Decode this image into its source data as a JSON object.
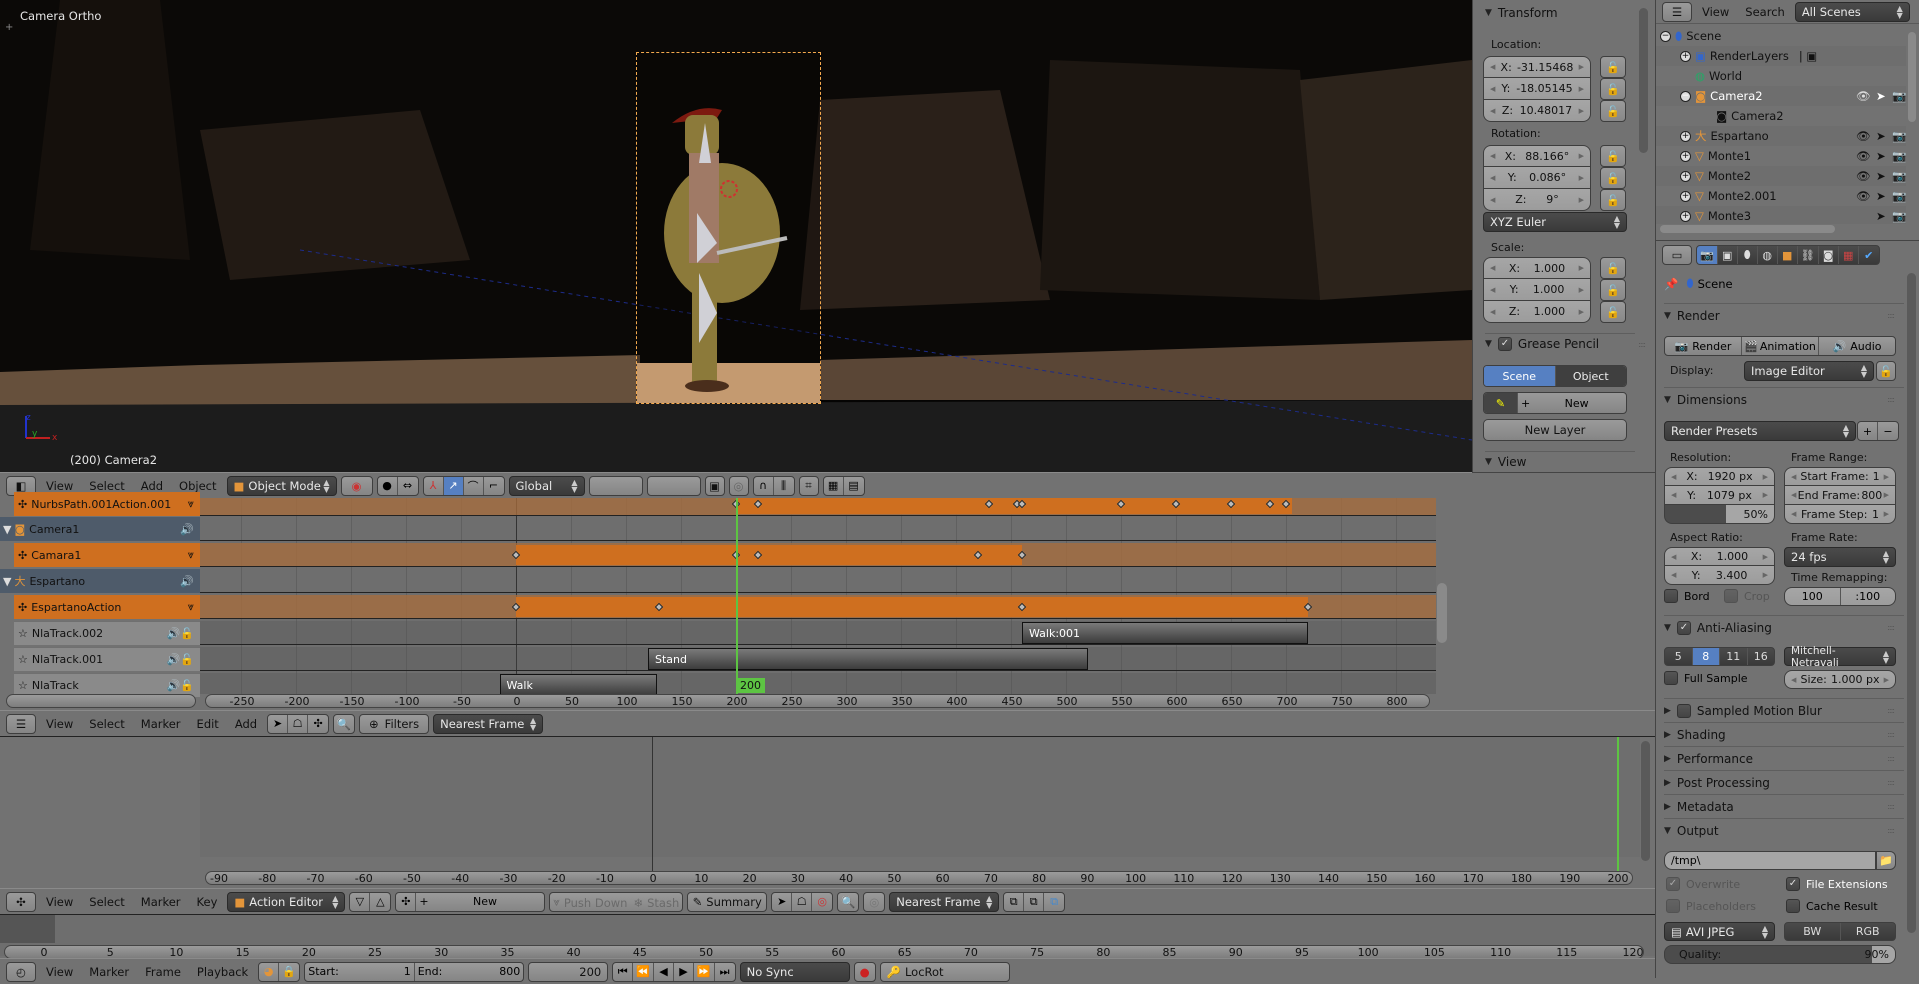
{
  "viewport": {
    "view_name": "Camera Ortho",
    "status": "(200) Camera2",
    "axes": {
      "x": "x",
      "y": "y",
      "z": "z"
    },
    "header": {
      "menus": [
        "View",
        "Select",
        "Add",
        "Object"
      ],
      "mode": "Object Mode",
      "orientation": "Global"
    }
  },
  "transform_panel": {
    "title": "Transform",
    "location_label": "Location:",
    "location": [
      {
        "axis": "X:",
        "value": "-31.15468"
      },
      {
        "axis": "Y:",
        "value": "-18.05145"
      },
      {
        "axis": "Z:",
        "value": "10.48017"
      }
    ],
    "rotation_label": "Rotation:",
    "rotation": [
      {
        "axis": "X:",
        "value": "88.166°"
      },
      {
        "axis": "Y:",
        "value": "0.086°"
      },
      {
        "axis": "Z:",
        "value": "9°"
      }
    ],
    "rotation_mode": "XYZ Euler",
    "scale_label": "Scale:",
    "scale": [
      {
        "axis": "X:",
        "value": "1.000"
      },
      {
        "axis": "Y:",
        "value": "1.000"
      },
      {
        "axis": "Z:",
        "value": "1.000"
      }
    ],
    "grease_pencil": {
      "title": "Grease Pencil",
      "enabled": true,
      "scene_label": "Scene",
      "object_label": "Object",
      "active": "Scene",
      "new_label": "New",
      "new_layer_label": "New Layer"
    },
    "view_title": "View"
  },
  "outliner": {
    "menus": [
      "View",
      "Search"
    ],
    "filter": "All Scenes",
    "items": [
      {
        "name": "Scene",
        "depth": 0,
        "icon": "scene-icon"
      },
      {
        "name": "RenderLayers",
        "depth": 1,
        "icon": "renderlayers-icon"
      },
      {
        "name": "World",
        "depth": 1,
        "icon": "world-icon"
      },
      {
        "name": "Camera2",
        "depth": 1,
        "icon": "camera-object-icon",
        "selected": true
      },
      {
        "name": "Camera2",
        "depth": 2,
        "icon": "camera-data-icon"
      },
      {
        "name": "Espartano",
        "depth": 1,
        "icon": "armature-icon"
      },
      {
        "name": "Monte1",
        "depth": 1,
        "icon": "mesh-icon"
      },
      {
        "name": "Monte2",
        "depth": 1,
        "icon": "mesh-icon"
      },
      {
        "name": "Monte2.001",
        "depth": 1,
        "icon": "mesh-icon"
      },
      {
        "name": "Monte3",
        "depth": 1,
        "icon": "mesh-icon"
      }
    ]
  },
  "properties": {
    "context": "Scene",
    "render": {
      "title": "Render",
      "render_btn": "Render",
      "animation_btn": "Animation",
      "audio_btn": "Audio",
      "display_label": "Display:",
      "display_value": "Image Editor"
    },
    "dimensions": {
      "title": "Dimensions",
      "presets": "Render Presets",
      "resolution_label": "Resolution:",
      "res_x": "1920 px",
      "res_y": "1079 px",
      "res_percent": "50%",
      "res_percent_value": 50,
      "frame_range_label": "Frame Range:",
      "start_frame": "Start Frame:",
      "start_value": "1",
      "end_frame": "End Frame:",
      "end_value": "800",
      "frame_step": "Frame Step:",
      "step_value": "1",
      "aspect_label": "Aspect Ratio:",
      "aspect_x": "1.000",
      "aspect_y": "3.400",
      "frame_rate_label": "Frame Rate:",
      "frame_rate": "24 fps",
      "time_remap_label": "Time Remapping:",
      "remap_old": "100",
      "remap_new": ":100",
      "bord": "Bord",
      "crop": "Crop"
    },
    "anti_aliasing": {
      "title": "Anti-Aliasing",
      "enabled": true,
      "samples": [
        "5",
        "8",
        "11",
        "16"
      ],
      "selected_sample": "8",
      "filter": "Mitchell-Netravali",
      "full_sample": "Full Sample",
      "size_label": "Size:",
      "size_value": "1.000 px"
    },
    "collapsed_sections": [
      "Sampled Motion Blur",
      "Shading",
      "Performance",
      "Post Processing",
      "Metadata"
    ],
    "output": {
      "title": "Output",
      "path": "/tmp\\",
      "overwrite": "Overwrite",
      "file_extensions": "File Extensions",
      "placeholders": "Placeholders",
      "cache_result": "Cache Result",
      "format": "AVI JPEG",
      "bw": "BW",
      "rgb": "RGB",
      "quality_label": "Quality:",
      "quality": "90%",
      "quality_value": 90
    }
  },
  "nla": {
    "channels": [
      {
        "name": "NurbsPath.001Action.001",
        "type": "action"
      },
      {
        "name": "Camera1",
        "type": "object"
      },
      {
        "name": "Camara1",
        "type": "action"
      },
      {
        "name": "Espartano",
        "type": "object"
      },
      {
        "name": "EspartanoAction",
        "type": "action"
      },
      {
        "name": "NlaTrack.002",
        "type": "track"
      },
      {
        "name": "NlaTrack.001",
        "type": "track"
      },
      {
        "name": "NlaTrack",
        "type": "track"
      }
    ],
    "current_frame": "200",
    "current_frame_value": 200,
    "ruler_ticks": [
      "-250",
      "-200",
      "-150",
      "-100",
      "-50",
      "0",
      "50",
      "100",
      "150",
      "200",
      "250",
      "300",
      "350",
      "400",
      "450",
      "500",
      "550",
      "600",
      "650",
      "700",
      "750",
      "800"
    ],
    "action_ranges": [
      {
        "row": 0,
        "start": 200,
        "end": 705,
        "keys": [
          200,
          220,
          430,
          455,
          460,
          550,
          600,
          650,
          685,
          700
        ]
      },
      {
        "row": 2,
        "start": 0,
        "end": 460,
        "keys": [
          0,
          200,
          220,
          420,
          460
        ]
      },
      {
        "row": 4,
        "start": 0,
        "end": 720,
        "keys": [
          0,
          130,
          460,
          720
        ]
      }
    ],
    "strips": [
      {
        "row": 5,
        "name": "Walk:001",
        "start": 460,
        "end": 720
      },
      {
        "row": 6,
        "name": "Stand",
        "start": 120,
        "end": 520
      },
      {
        "row": 7,
        "name": "Walk",
        "start": -15,
        "end": 128
      }
    ],
    "header": {
      "menus": [
        "View",
        "Select",
        "Marker",
        "Edit",
        "Add"
      ],
      "filters": "Filters",
      "snap": "Nearest Frame"
    }
  },
  "graph": {
    "ruler_ticks": [
      "-90",
      "-80",
      "-70",
      "-60",
      "-50",
      "-40",
      "-30",
      "-20",
      "-10",
      "0",
      "10",
      "20",
      "30",
      "40",
      "50",
      "60",
      "70",
      "80",
      "90",
      "100",
      "110",
      "120",
      "130",
      "140",
      "150",
      "160",
      "170",
      "180",
      "190",
      "200"
    ],
    "current_frame": "200"
  },
  "action_editor": {
    "menus": [
      "View",
      "Select",
      "Marker",
      "Key"
    ],
    "mode": "Action Editor",
    "new_label": "New",
    "push_down": "Push Down",
    "stash": "Stash",
    "summary": "Summary",
    "snap": "Nearest Frame",
    "ruler_ticks": [
      "0",
      "5",
      "10",
      "15",
      "20",
      "25",
      "30",
      "35",
      "40",
      "45",
      "50",
      "55",
      "60",
      "65",
      "70",
      "75",
      "80",
      "85",
      "90",
      "95",
      "100",
      "105",
      "110",
      "115",
      "120"
    ]
  },
  "timeline": {
    "menus": [
      "View",
      "Marker",
      "Frame",
      "Playback"
    ],
    "start_label": "Start:",
    "start": "1",
    "end_label": "End:",
    "end": "800",
    "current": "200",
    "sync": "No Sync",
    "keying_set": "LocRot"
  }
}
